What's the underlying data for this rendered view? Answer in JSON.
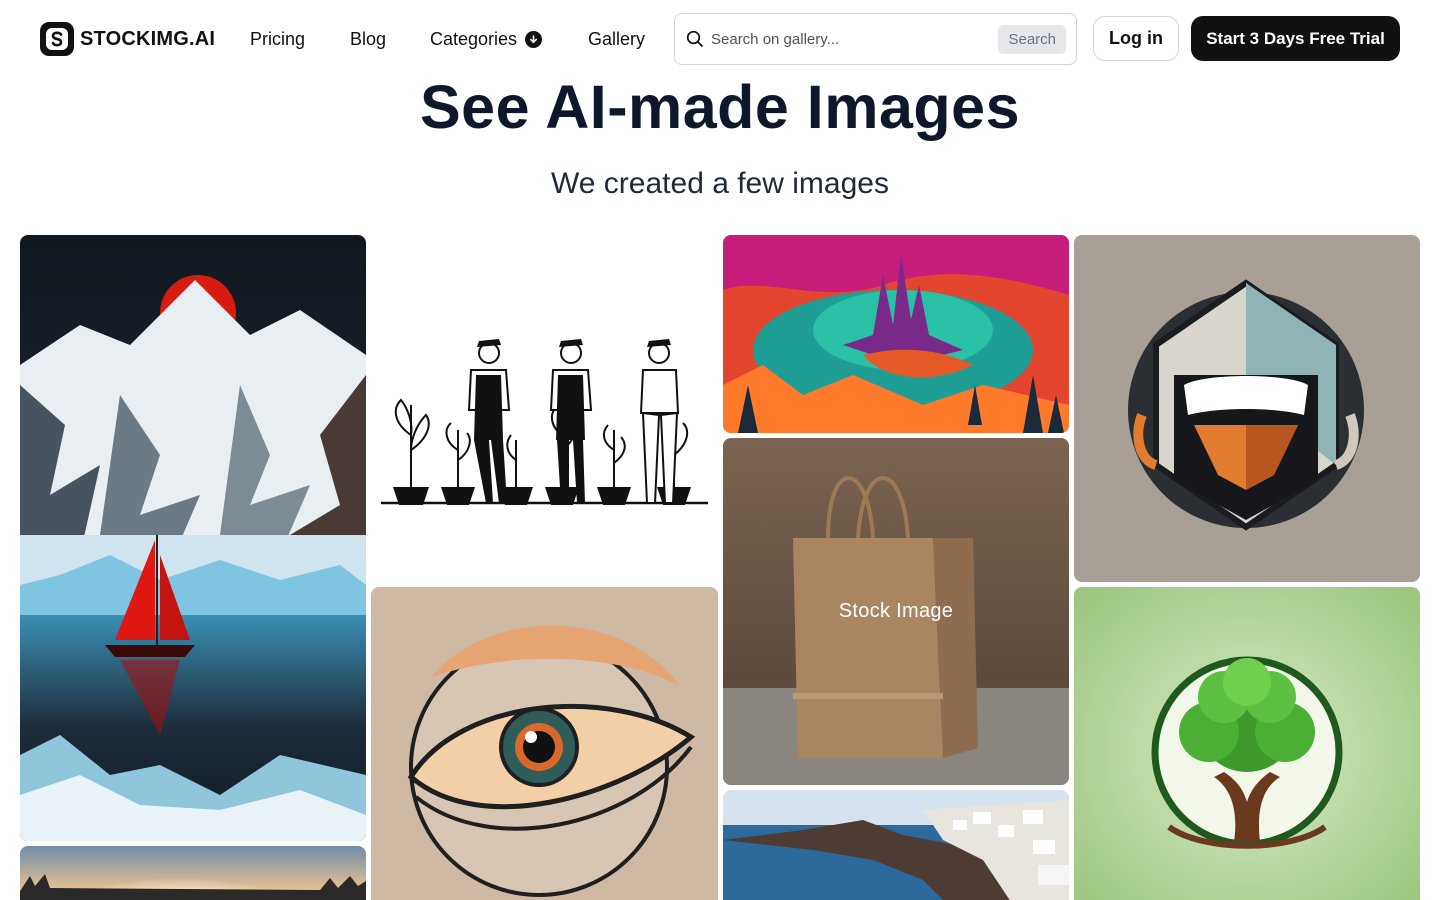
{
  "brand": {
    "name": "STOCKIMG.AI"
  },
  "nav": {
    "links": [
      {
        "label": "Pricing"
      },
      {
        "label": "Blog"
      },
      {
        "label": "Categories"
      },
      {
        "label": "Gallery"
      }
    ],
    "search": {
      "placeholder": "Search on gallery...",
      "button": "Search"
    },
    "login": "Log in",
    "cta": "Start 3 Days Free Trial"
  },
  "hero": {
    "title": "See AI-made Images",
    "subtitle": "We created a few images"
  },
  "gallery": {
    "hover_label": "Stock Image",
    "items": [
      {
        "icon": "mountain-sailboat-image"
      },
      {
        "icon": "sunset-forest-image"
      },
      {
        "icon": "gardeners-line-art-image"
      },
      {
        "icon": "eye-logo-image"
      },
      {
        "icon": "fantasy-landscape-image"
      },
      {
        "icon": "paper-bag-image"
      },
      {
        "icon": "coastal-village-image"
      },
      {
        "icon": "hooded-mascot-logo-image"
      },
      {
        "icon": "tree-logo-image"
      }
    ]
  },
  "colors": {
    "primary": "#111111",
    "title": "#0f172a",
    "border": "#d4d4d8"
  }
}
